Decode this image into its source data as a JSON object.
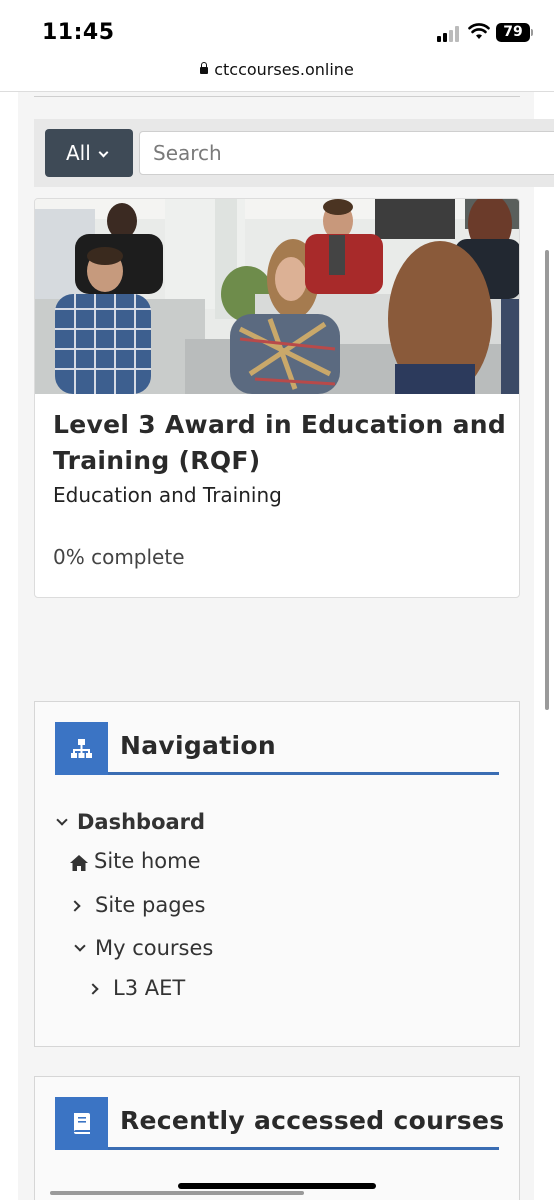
{
  "status_bar": {
    "time": "11:45",
    "battery": "79",
    "icons": [
      "cellular-signal-icon",
      "wifi-icon",
      "battery-icon"
    ]
  },
  "browser": {
    "url": "ctccourses.online",
    "icon": "lock-icon"
  },
  "course_search": {
    "filter_label": "All",
    "placeholder": "Search"
  },
  "course_card": {
    "image": "classroom-photo",
    "title": "Level 3 Award in Education and Training (RQF)",
    "category": "Education and Training",
    "progress_text": "0% complete"
  },
  "navigation_block": {
    "title": "Navigation",
    "icon": "sitemap-icon",
    "accent_color": "#3b74c4",
    "items": [
      {
        "label": "Dashboard",
        "icon": "chevron-down-icon"
      },
      {
        "label": "Site home",
        "icon": "home-icon"
      },
      {
        "label": "Site pages",
        "icon": "chevron-right-icon"
      },
      {
        "label": "My courses",
        "icon": "chevron-down-icon"
      },
      {
        "label": "L3 AET",
        "icon": "chevron-right-icon"
      }
    ]
  },
  "recent_block": {
    "title": "Recently accessed courses",
    "icon": "book-icon"
  }
}
